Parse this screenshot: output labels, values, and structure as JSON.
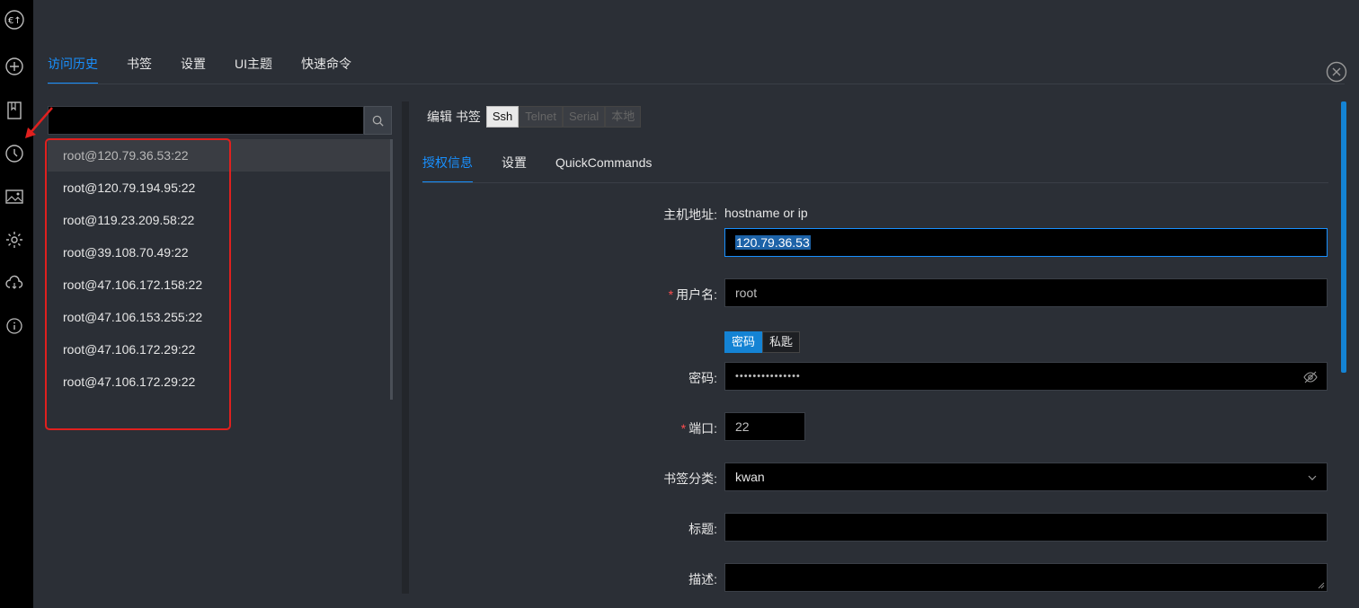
{
  "sidebar": {
    "icons": [
      "app-logo-icon",
      "add-icon",
      "bookmark-icon",
      "history-icon",
      "image-icon",
      "settings-icon",
      "cloud-sync-icon",
      "info-icon"
    ]
  },
  "top_tabs": [
    "访问历史",
    "书签",
    "设置",
    "UI主题",
    "快速命令"
  ],
  "history": [
    "root@120.79.36.53:22",
    "root@120.79.194.95:22",
    "root@119.23.209.58:22",
    "root@39.108.70.49:22",
    "root@47.106.172.158:22",
    "root@47.106.153.255:22",
    "root@47.106.172.29:22",
    "root@47.106.172.29:22"
  ],
  "editor": {
    "label": "编辑 书签",
    "types": [
      "Ssh",
      "Telnet",
      "Serial",
      "本地"
    ],
    "subtabs": [
      "授权信息",
      "设置",
      "QuickCommands"
    ],
    "host_label": "主机地址:",
    "host_hint": "hostname or ip",
    "host_value": "120.79.36.53",
    "user_label": "用户名:",
    "user_value": "root",
    "auth_options": [
      "密码",
      "私匙"
    ],
    "password_label": "密码:",
    "password_value": "•••••••••••••••",
    "port_label": "端口:",
    "port_value": "22",
    "category_label": "书签分类:",
    "category_value": "kwan",
    "title_label": "标题:",
    "desc_label": "描述:"
  },
  "colors": {
    "accent": "#1890ff",
    "annotation": "#e0201e"
  }
}
